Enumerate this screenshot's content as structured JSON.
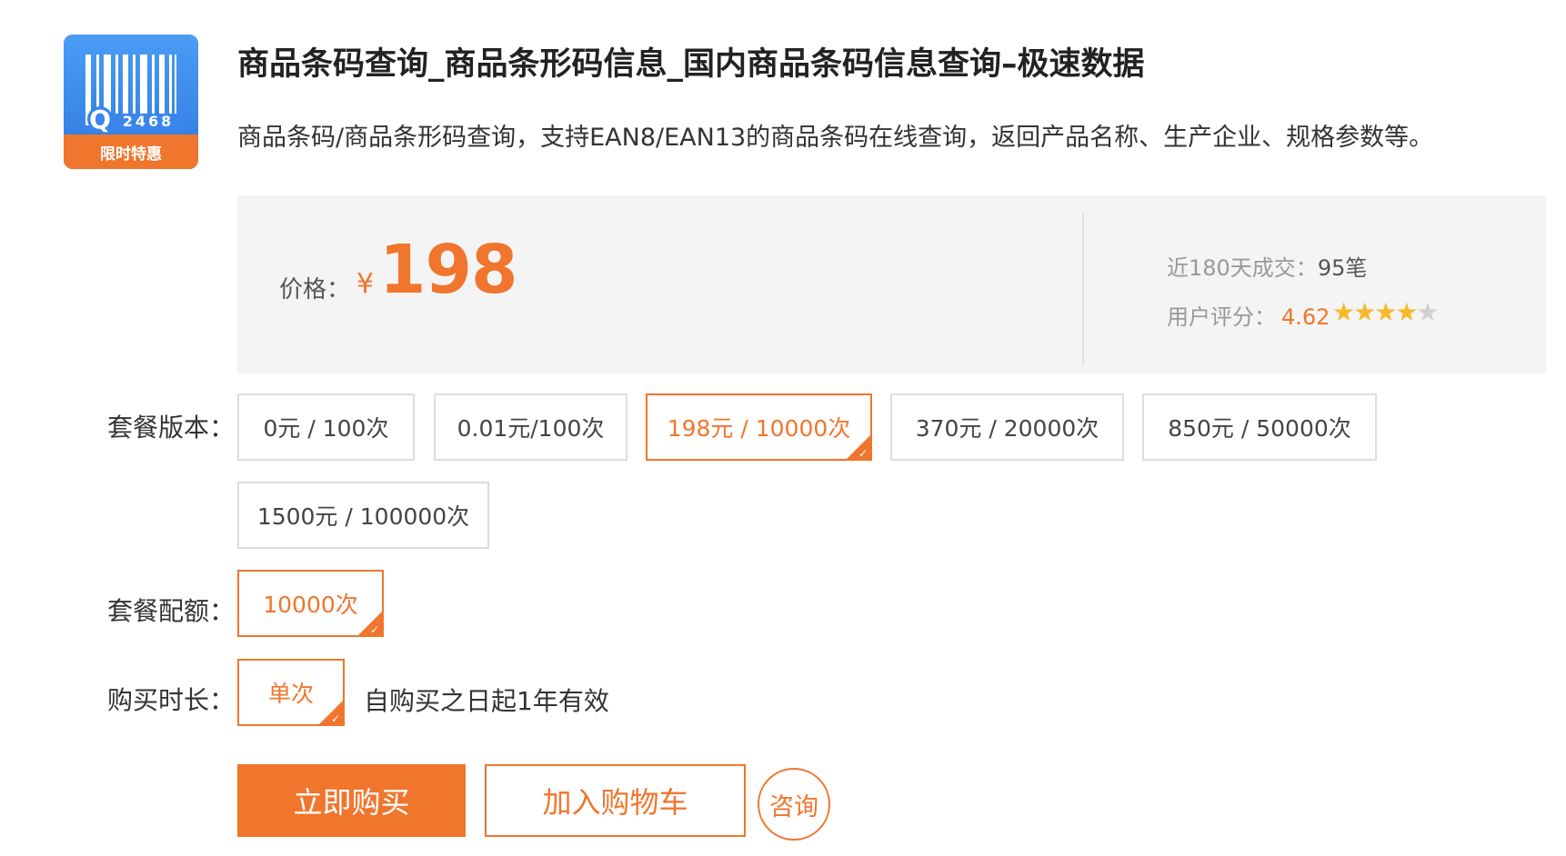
{
  "product": {
    "title": "商品条码查询_商品条形码信息_国内商品条码信息查询–极速数据",
    "description": "商品条码/商品条形码查询，支持EAN8/EAN13的商品条码在线查询，返回产品名称、生产企业、规格参数等。",
    "logo": {
      "icon": "barcode-icon",
      "digits": "2468",
      "q_letter": "Q",
      "badge": "限时特惠",
      "colors": {
        "top": "#4a9cf5",
        "bottom": "#2f7ae0",
        "badge": "#f0762e"
      }
    }
  },
  "pricing": {
    "price_label": "价格：",
    "currency": "¥",
    "price": "198",
    "sales_label": "近180天成交：",
    "sales_value": "95笔",
    "rating_label": "用户评分：",
    "rating_value": "4.62",
    "stars": "★★★★",
    "star_partial": "★",
    "rating_fraction": 0.924
  },
  "package": {
    "label": "套餐版本：",
    "options": [
      {
        "label": "0元 / 100次",
        "selected": false
      },
      {
        "label": "0.01元/100次",
        "selected": false
      },
      {
        "label": "198元 / 10000次",
        "selected": true
      },
      {
        "label": "370元 / 20000次",
        "selected": false
      },
      {
        "label": "850元 / 50000次",
        "selected": false
      },
      {
        "label": "1500元 / 100000次",
        "selected": false
      }
    ]
  },
  "quota": {
    "label": "套餐配额：",
    "options": [
      {
        "label": "10000次",
        "selected": true
      }
    ]
  },
  "duration": {
    "label": "购买时长：",
    "options": [
      {
        "label": "单次",
        "selected": true
      }
    ],
    "validity": "自购买之日起1年有效"
  },
  "actions": {
    "buy": "立即购买",
    "cart": "加入购物车",
    "consult": "咨询"
  },
  "colors": {
    "accent": "#f0762e",
    "star": "#f7b92a",
    "panel": "#f4f4f4"
  }
}
